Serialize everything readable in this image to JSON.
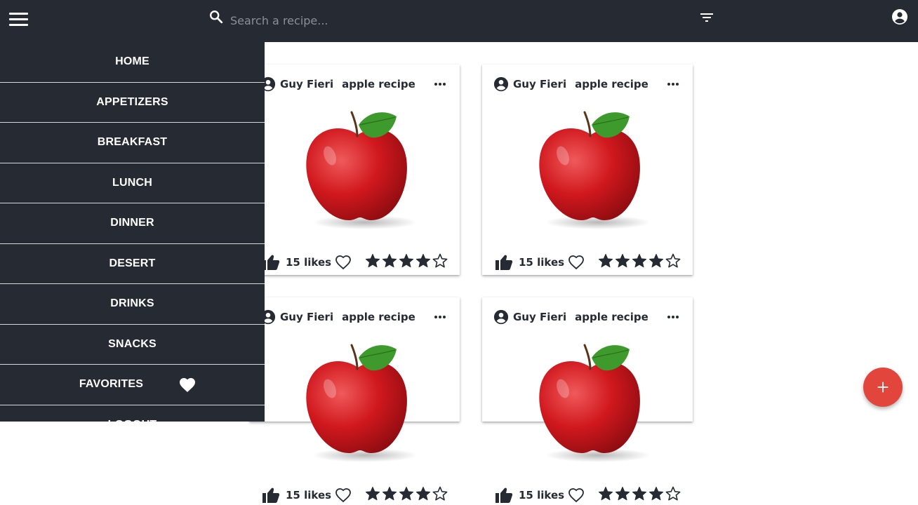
{
  "header": {
    "search": {
      "placeholder": "Search a recipe..."
    },
    "icons": {
      "menu": "menu-icon",
      "search": "search-icon",
      "filter": "filter-icon",
      "account": "account-circle-icon"
    }
  },
  "drawer": {
    "items": [
      {
        "label": "HOME"
      },
      {
        "label": "APPETIZERS"
      },
      {
        "label": "BREAKFAST"
      },
      {
        "label": "LUNCH"
      },
      {
        "label": "DINNER"
      },
      {
        "label": "DESERT"
      },
      {
        "label": "DRINKS"
      },
      {
        "label": "SNACKS"
      },
      {
        "label": "FAVORITES",
        "icon": "heart-icon"
      },
      {
        "label": "LOGOUT"
      }
    ]
  },
  "recipes": [
    {
      "author": "Guy Fieri",
      "title": "apple recipe",
      "likes": "15 likes",
      "rating": 4,
      "max_rating": 5
    },
    {
      "author": "Guy Fieri",
      "title": "apple recipe",
      "likes": "15 likes",
      "rating": 4,
      "max_rating": 5
    },
    {
      "author": "Guy Fieri",
      "title": "apple recipe",
      "likes": "15 likes",
      "rating": 4,
      "max_rating": 5
    },
    {
      "author": "Guy Fieri",
      "title": "apple recipe",
      "likes": "15 likes",
      "rating": 4,
      "max_rating": 5
    }
  ],
  "fab": {
    "label": "+",
    "icon": "plus-icon"
  },
  "colors": {
    "header_bg": "#262a33",
    "drawer_bg": "#262a33",
    "fab": "#e2453c",
    "text_dark": "#262a33"
  }
}
